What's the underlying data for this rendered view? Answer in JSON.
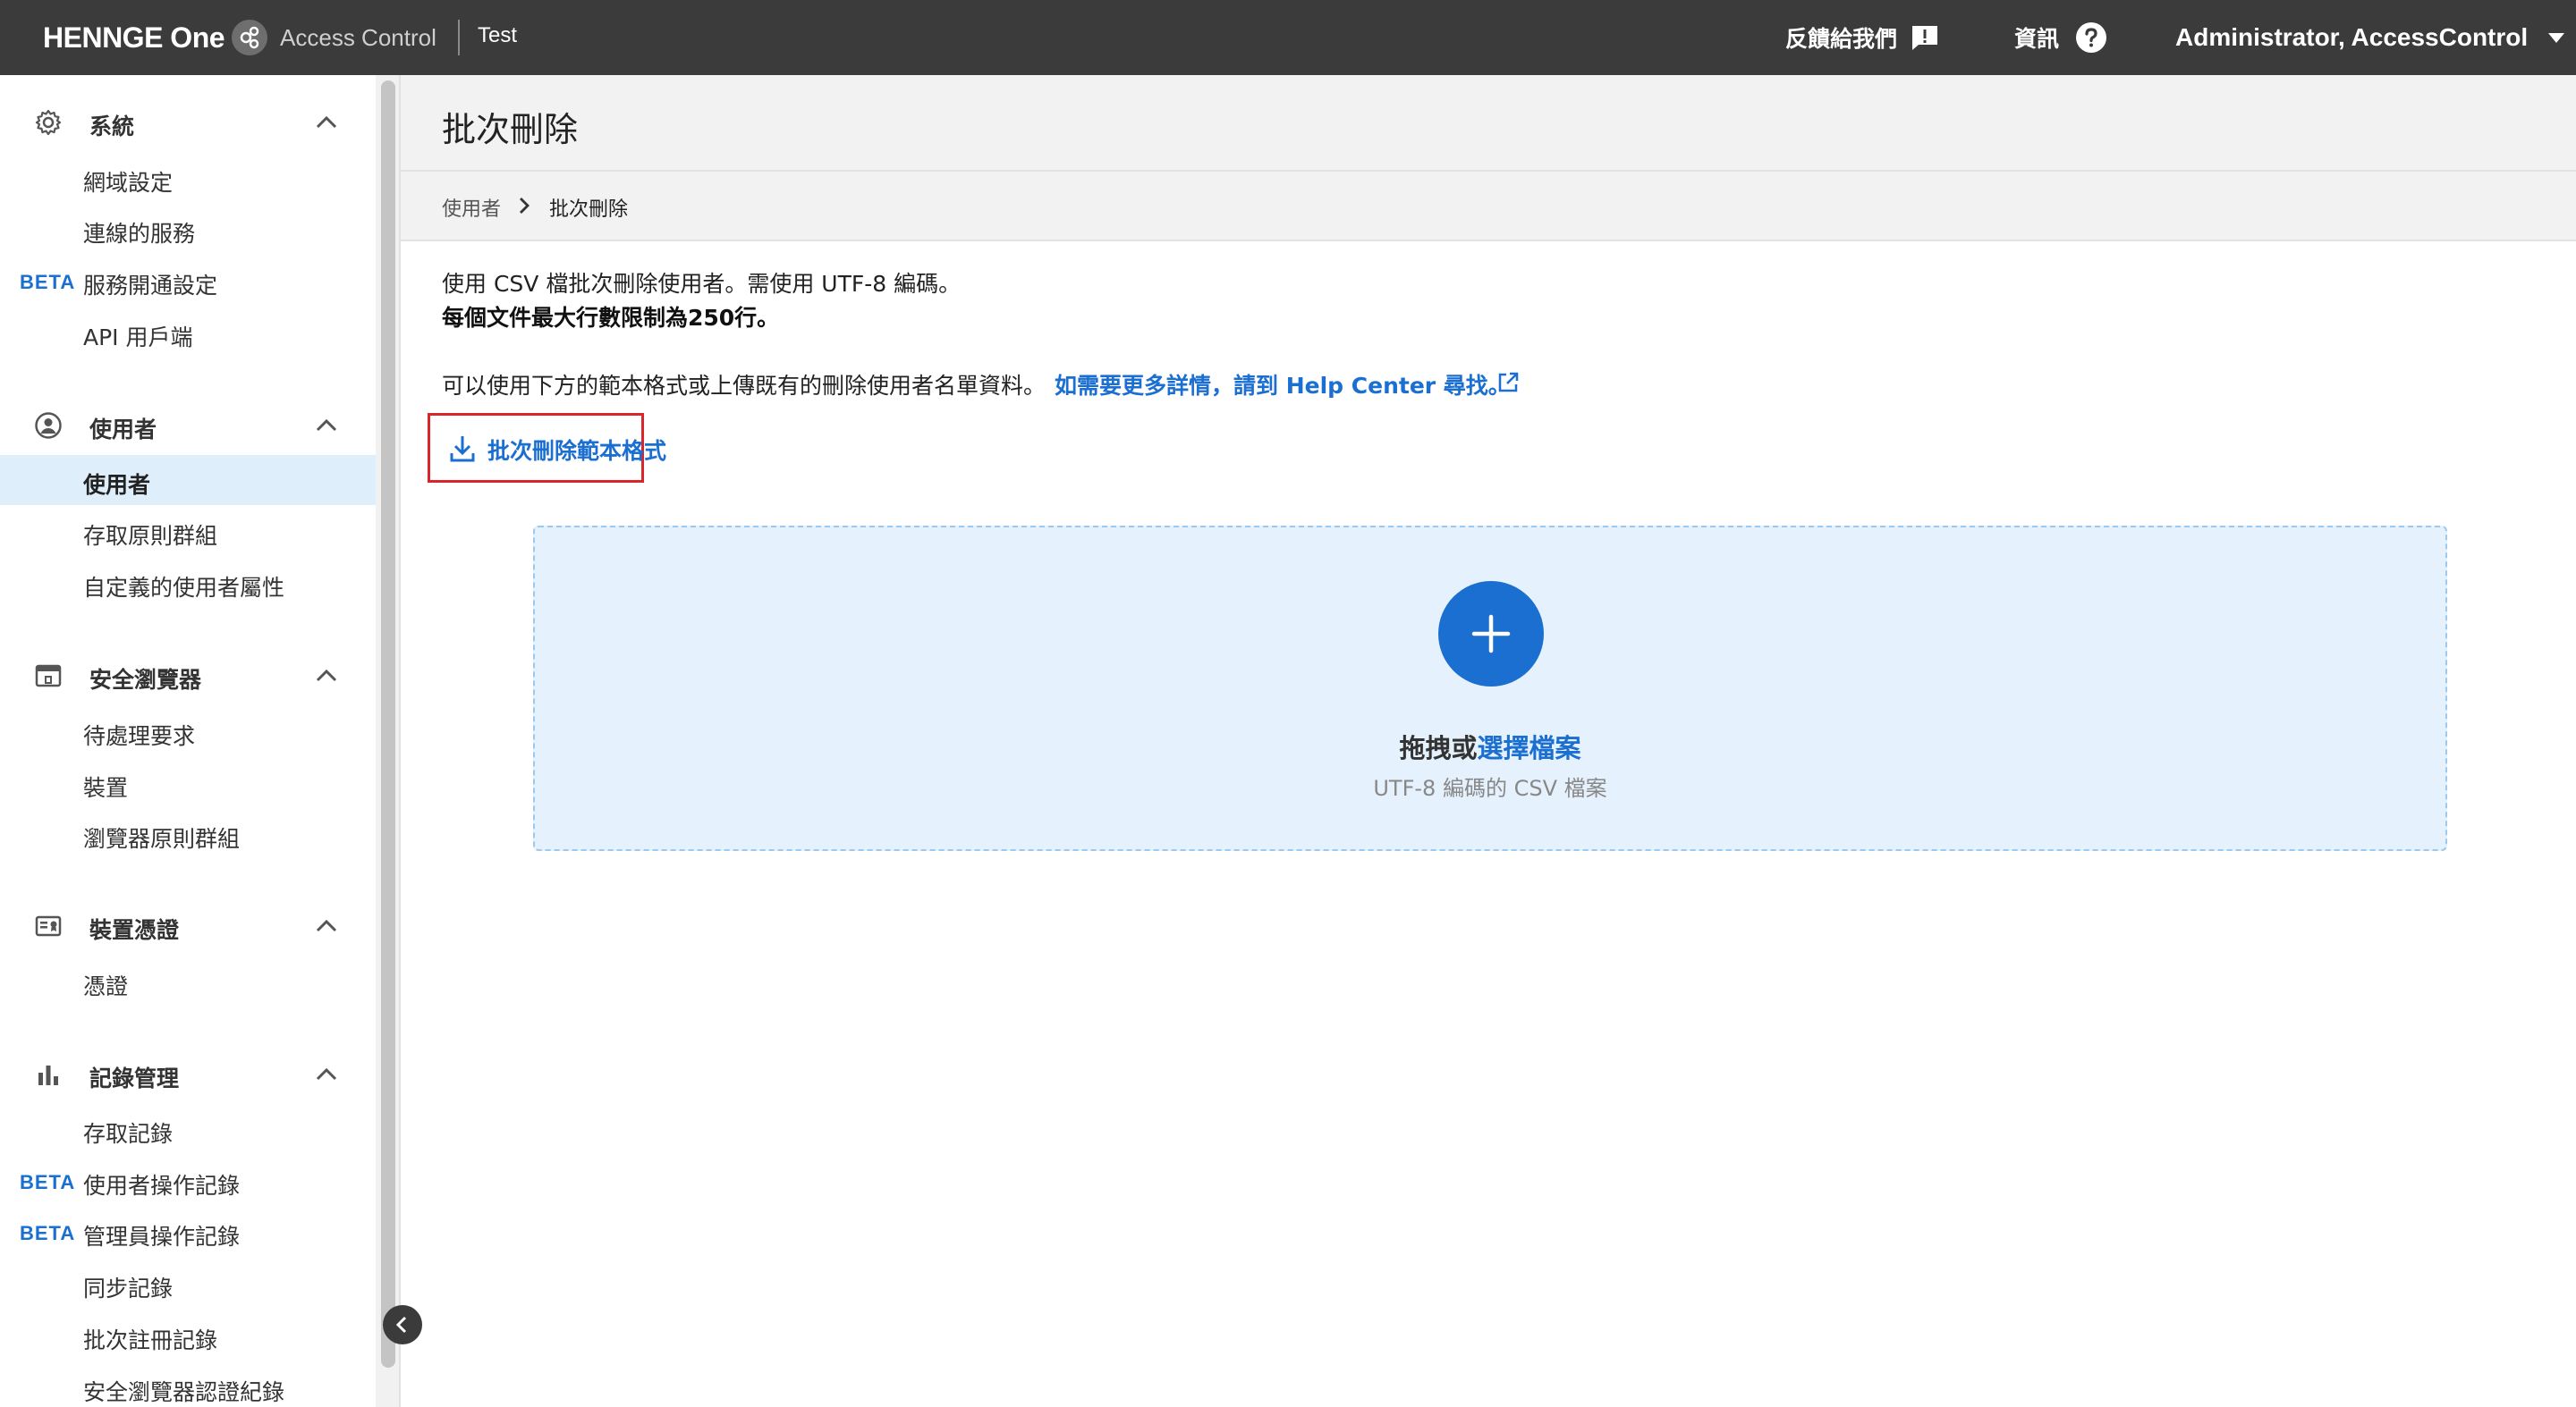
{
  "topbar": {
    "brand": "HENNGE One",
    "product": "Access Control",
    "tenant": "Test",
    "feedback_label": "反饋給我們",
    "info_label": "資訊",
    "user_label": "Administrator, AccessControl"
  },
  "sidebar": {
    "sections": [
      {
        "title": "系統",
        "icon": "gear-icon",
        "items": [
          {
            "label": "網域設定",
            "beta": ""
          },
          {
            "label": "連線的服務",
            "beta": ""
          },
          {
            "label": "服務開通設定",
            "beta": "BETA"
          },
          {
            "label": "API 用戶端",
            "beta": ""
          }
        ]
      },
      {
        "title": "使用者",
        "icon": "user-circle-icon",
        "items": [
          {
            "label": "使用者",
            "beta": "",
            "active": true
          },
          {
            "label": "存取原則群組",
            "beta": ""
          },
          {
            "label": "自定義的使用者屬性",
            "beta": ""
          }
        ]
      },
      {
        "title": "安全瀏覽器",
        "icon": "browser-icon",
        "items": [
          {
            "label": "待處理要求",
            "beta": ""
          },
          {
            "label": "裝置",
            "beta": ""
          },
          {
            "label": "瀏覽器原則群組",
            "beta": ""
          }
        ]
      },
      {
        "title": "裝置憑證",
        "icon": "certificate-icon",
        "items": [
          {
            "label": "憑證",
            "beta": ""
          }
        ]
      },
      {
        "title": "記錄管理",
        "icon": "bar-chart-icon",
        "items": [
          {
            "label": "存取記錄",
            "beta": ""
          },
          {
            "label": "使用者操作記錄",
            "beta": "BETA"
          },
          {
            "label": "管理員操作記錄",
            "beta": "BETA"
          },
          {
            "label": "同步記錄",
            "beta": ""
          },
          {
            "label": "批次註冊記錄",
            "beta": ""
          },
          {
            "label": "安全瀏覽器認證紀錄",
            "beta": ""
          }
        ]
      }
    ]
  },
  "main": {
    "title": "批次刪除",
    "breadcrumb": [
      "使用者",
      "批次刪除"
    ],
    "description_line1": "使用 CSV 檔批次刪除使用者。需使用 UTF-8 編碼。",
    "description_line2": "每個文件最大行數限制為250行。",
    "description_line3": "可以使用下方的範本格式或上傳既有的刪除使用者名單資料。",
    "help_link": "如需要更多詳情，請到 Help Center 尋找。",
    "template_button": "批次刪除範本格式",
    "dropzone": {
      "prefix": "拖拽或",
      "link": "選擇檔案",
      "subtitle": "UTF-8 編碼的 CSV 檔案"
    }
  },
  "colors": {
    "topbar_bg": "#3b3b3b",
    "accent": "#1a6fd0",
    "highlight_border": "#d9262c",
    "active_item_bg": "#dfeefb",
    "dropzone_bg": "#e5f1fc"
  }
}
